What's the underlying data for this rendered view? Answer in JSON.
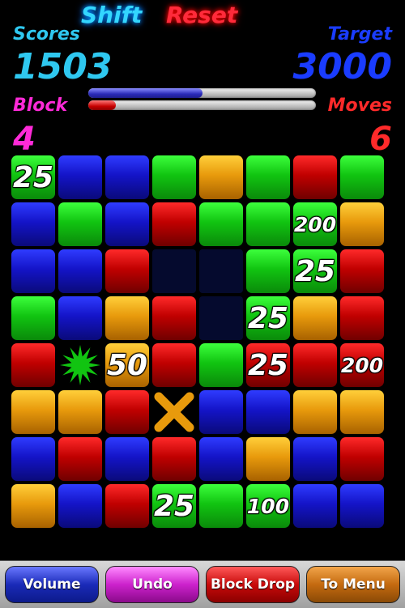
{
  "header": {
    "shift_label": "Shift",
    "reset_label": "Reset"
  },
  "stats": {
    "scores_label": "Scores",
    "scores_value": "1503",
    "target_label": "Target",
    "target_value": "3000",
    "block_label": "Block",
    "block_value": "4",
    "moves_label": "Moves",
    "moves_value": "6"
  },
  "progress": {
    "score_fraction": 0.5,
    "block_fraction": 0.12
  },
  "colors": {
    "green": "#11c411",
    "blue": "#1414c8",
    "red": "#c00000",
    "orange": "#e89a0c",
    "empty": "#050a2e"
  },
  "board": {
    "rows": 8,
    "cols": 8,
    "cells": [
      [
        {
          "c": "green",
          "t": "25"
        },
        {
          "c": "blue"
        },
        {
          "c": "blue"
        },
        {
          "c": "green"
        },
        {
          "c": "orange"
        },
        {
          "c": "green"
        },
        {
          "c": "red"
        },
        {
          "c": "green"
        }
      ],
      [
        {
          "c": "blue"
        },
        {
          "c": "green"
        },
        {
          "c": "blue"
        },
        {
          "c": "red"
        },
        {
          "c": "green"
        },
        {
          "c": "green"
        },
        {
          "c": "green",
          "t": "200"
        },
        {
          "c": "orange"
        }
      ],
      [
        {
          "c": "blue"
        },
        {
          "c": "blue"
        },
        {
          "c": "red"
        },
        {
          "c": "empty"
        },
        {
          "c": "empty"
        },
        {
          "c": "green"
        },
        {
          "c": "green",
          "t": "25"
        },
        {
          "c": "red"
        }
      ],
      [
        {
          "c": "green"
        },
        {
          "c": "blue"
        },
        {
          "c": "orange"
        },
        {
          "c": "red"
        },
        {
          "c": "empty"
        },
        {
          "c": "green",
          "t": "25"
        },
        {
          "c": "orange"
        },
        {
          "c": "red"
        }
      ],
      [
        {
          "c": "red"
        },
        {
          "c": "none",
          "icon": "star-burst-icon"
        },
        {
          "c": "orange",
          "t": "50"
        },
        {
          "c": "red"
        },
        {
          "c": "green"
        },
        {
          "c": "red",
          "t": "25"
        },
        {
          "c": "red"
        },
        {
          "c": "red",
          "t": "200"
        }
      ],
      [
        {
          "c": "orange"
        },
        {
          "c": "orange"
        },
        {
          "c": "red"
        },
        {
          "c": "none",
          "icon": "x-bomb-icon"
        },
        {
          "c": "blue"
        },
        {
          "c": "blue"
        },
        {
          "c": "orange"
        },
        {
          "c": "orange"
        }
      ],
      [
        {
          "c": "blue"
        },
        {
          "c": "red"
        },
        {
          "c": "blue"
        },
        {
          "c": "red"
        },
        {
          "c": "blue"
        },
        {
          "c": "orange"
        },
        {
          "c": "blue"
        },
        {
          "c": "red"
        }
      ],
      [
        {
          "c": "orange"
        },
        {
          "c": "blue"
        },
        {
          "c": "red"
        },
        {
          "c": "green",
          "t": "25"
        },
        {
          "c": "green"
        },
        {
          "c": "green",
          "t": "100"
        },
        {
          "c": "blue"
        },
        {
          "c": "blue"
        }
      ]
    ]
  },
  "footer": {
    "volume_label": "Volume",
    "undo_label": "Undo",
    "block_drop_label": "Block Drop",
    "menu_label": "To Menu"
  }
}
